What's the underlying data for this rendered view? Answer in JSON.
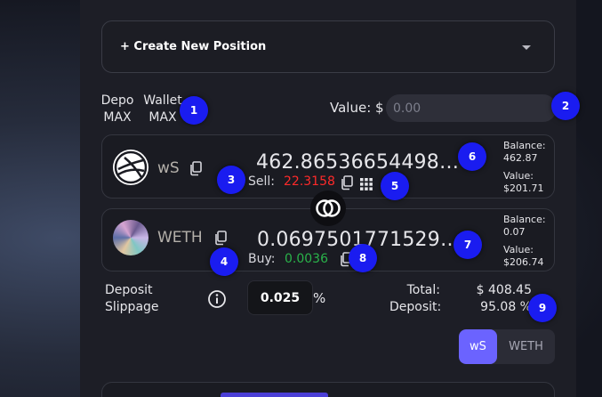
{
  "create_position": {
    "label": "+ Create New Position"
  },
  "max_links": {
    "depo_top": "Depo",
    "depo_bottom": "MAX",
    "wallet_top": "Wallet",
    "wallet_bottom": "MAX"
  },
  "value_field": {
    "label": "Value: $",
    "placeholder": "0.00"
  },
  "sell_token": {
    "symbol": "wS",
    "amount": "462.86536654498…",
    "price_label": "Sell:",
    "price": "22.3158",
    "balance_label": "Balance:",
    "balance": "462.87",
    "value_label": "Value:",
    "value": "$201.71",
    "icon": "sonic-s-logo"
  },
  "buy_token": {
    "symbol": "WETH",
    "amount": "0.0697501771529…",
    "price_label": "Buy:",
    "price": "0.0036",
    "balance_label": "Balance:",
    "balance": "0.07",
    "value_label": "Value:",
    "value": "$206.74",
    "icon": "weth-holographic-logo"
  },
  "swap": {
    "icon": "swap-rings-icon"
  },
  "slippage": {
    "label_line1": "Deposit",
    "label_line2": "Slippage",
    "value": "0.025",
    "unit": "%"
  },
  "totals": {
    "total_label": "Total:",
    "total_value": "$ 408.45",
    "deposit_label": "Deposit:",
    "deposit_value": "95.08 %"
  },
  "token_toggle": {
    "options": [
      "wS",
      "WETH"
    ],
    "selected": "wS"
  },
  "badges": [
    "1",
    "2",
    "3",
    "4",
    "5",
    "6",
    "7",
    "8",
    "9"
  ],
  "colors": {
    "accent": "#6b63ff",
    "sell_price": "#ff2a2a",
    "buy_price": "#2ab34a",
    "badge": "#1a1cf0"
  }
}
